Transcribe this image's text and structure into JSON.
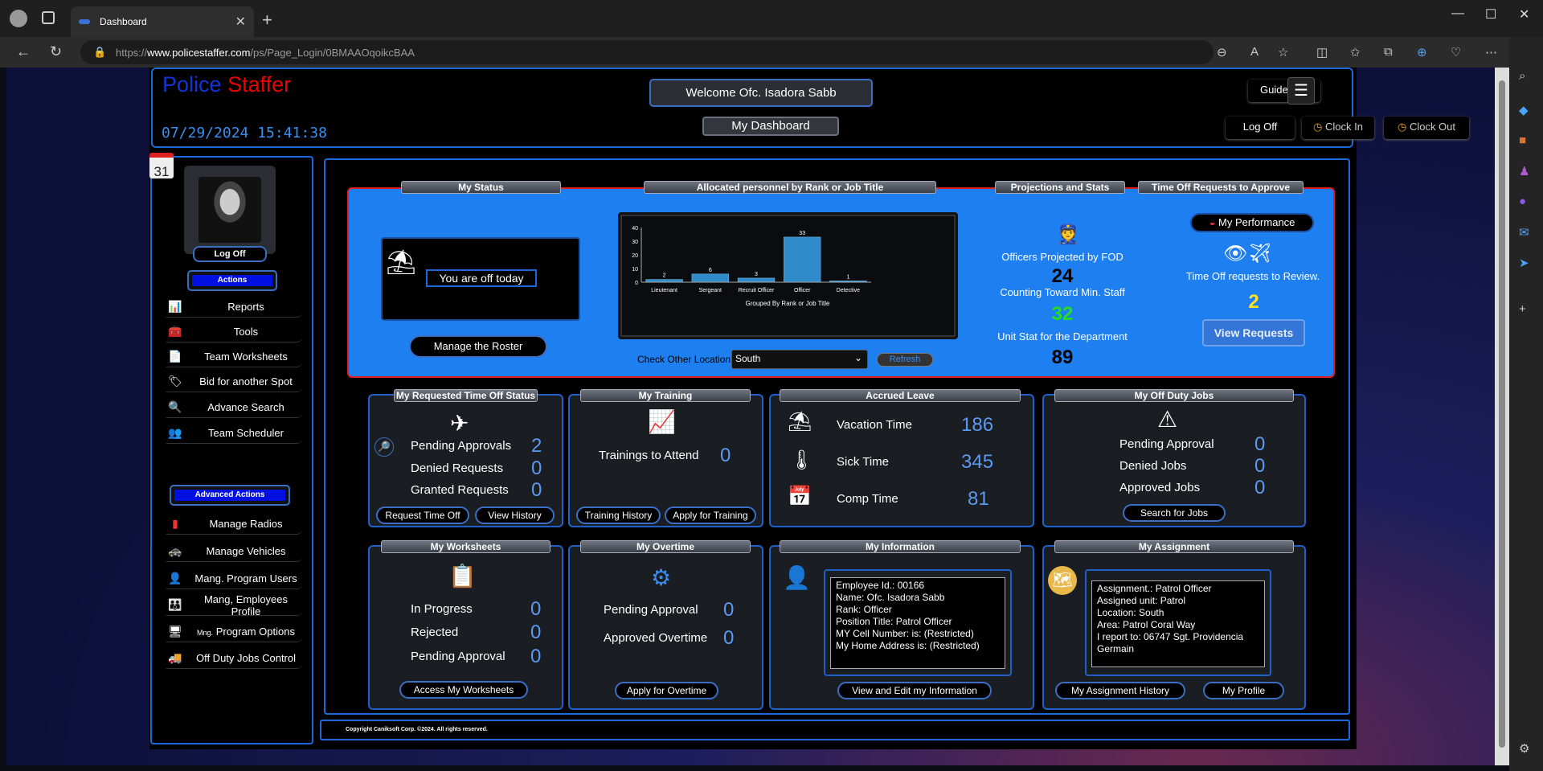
{
  "browser": {
    "tab_title": "Dashboard",
    "url_prefix": "https://",
    "url_host": "www.policestaffer.com",
    "url_path": "/ps/Page_Login/0BMAAOqoikcBAA"
  },
  "header": {
    "logo_police": "Police",
    "logo_staffer": "Staffer",
    "datetime": "07/29/2024 15:41:38",
    "welcome": "Welcome Ofc. Isadora Sabb",
    "page_title": "My Dashboard",
    "guide": "Guide Me.",
    "log_off": "Log Off",
    "clock_in": "Clock In",
    "clock_out": "Clock Out"
  },
  "sidebar": {
    "calendar_day": "31",
    "log_off": "Log Off",
    "actions_label": "Actions",
    "items": [
      "Reports",
      "Tools",
      "Team Worksheets",
      "Bid for another Spot",
      "Advance Search",
      "Team Scheduler"
    ],
    "advanced_label": "Advanced Actions",
    "advanced_items": [
      "Manage Radios",
      "Manage Vehicles",
      "Mang. Program Users",
      "Mang, Employees Profile",
      "Program Options",
      "Off Duty Jobs Control"
    ],
    "program_options_prefix": "Mng."
  },
  "top_panel": {
    "my_status_title": "My Status",
    "off_today": "You are off today",
    "manage_roster": "Manage the Roster",
    "allocated_title": "Allocated personnel by Rank or Job Title",
    "check_location_label": "Check Other Location",
    "location_value": "South",
    "refresh": "Refresh",
    "projections_title": "Projections and Stats",
    "officers_projected_label": "Officers Projected by FOD",
    "officers_projected_value": "24",
    "counting_label": "Counting Toward Min. Staff",
    "counting_value": "32",
    "unit_stat_label": "Unit Stat for the Department",
    "unit_stat_value": "89",
    "time_off_title": "Time Off Requests to Approve",
    "my_performance": "My Performance",
    "review_label": "Time Off requests to Review.",
    "review_value": "2",
    "view_requests": "View Requests"
  },
  "chart_data": {
    "type": "bar",
    "categories": [
      "Lieutenant",
      "Sergeant",
      "Recruit Officer",
      "Officer",
      "Detective"
    ],
    "values": [
      2,
      6,
      3,
      33,
      1
    ],
    "xlabel": "Grouped By Rank or Job Title",
    "ylabel": "",
    "ylim": [
      0,
      40
    ],
    "yticks": [
      "40",
      "30",
      "20",
      "10",
      "0"
    ],
    "bar_color": "#2f8bc9"
  },
  "time_off_status": {
    "title": "My Requested Time Off Status",
    "rows": [
      {
        "label": "Pending Approvals",
        "value": "2"
      },
      {
        "label": "Denied Requests",
        "value": "0"
      },
      {
        "label": "Granted Requests",
        "value": "0"
      }
    ],
    "request_btn": "Request Time Off",
    "history_btn": "View History"
  },
  "training": {
    "title": "My Training",
    "label": "Trainings to Attend",
    "value": "0",
    "history_btn": "Training History",
    "apply_btn": "Apply for Training"
  },
  "leave": {
    "title": "Accrued Leave",
    "rows": [
      {
        "label": "Vacation Time",
        "value": "186"
      },
      {
        "label": "Sick Time",
        "value": "345"
      },
      {
        "label": "Comp Time",
        "value": "81"
      }
    ]
  },
  "off_duty": {
    "title": "My Off Duty Jobs",
    "rows": [
      {
        "label": "Pending Approval",
        "value": "0"
      },
      {
        "label": "Denied Jobs",
        "value": "0"
      },
      {
        "label": "Approved Jobs",
        "value": "0"
      }
    ],
    "search_btn": "Search for Jobs"
  },
  "worksheets": {
    "title": "My Worksheets",
    "rows": [
      {
        "label": "In Progress",
        "value": "0"
      },
      {
        "label": "Rejected",
        "value": "0"
      },
      {
        "label": "Pending Approval",
        "value": "0"
      }
    ],
    "access_btn": "Access My Worksheets"
  },
  "overtime": {
    "title": "My Overtime",
    "rows": [
      {
        "label": "Pending Approval",
        "value": "0"
      },
      {
        "label": "Approved Overtime",
        "value": "0"
      }
    ],
    "apply_btn": "Apply for Overtime"
  },
  "information": {
    "title": "My Information",
    "lines": [
      "Employee Id.: 00166",
      "Name: Ofc. Isadora Sabb",
      "Rank: Officer",
      "Position Title: Patrol Officer",
      "MY Cell Number: is: (Restricted)",
      "My Home Address is: (Restricted)"
    ],
    "edit_btn": "View and Edit my Information"
  },
  "assignment": {
    "title": "My Assignment",
    "lines": [
      "Assignment.: Patrol Officer",
      "Assigned unit: Patrol",
      "Location: South",
      "Area: Patrol Coral Way",
      "I report to: 06747 Sgt. Providencia",
      "Germain"
    ],
    "history_btn": "My Assignment History",
    "profile_btn": "My Profile"
  },
  "footer": {
    "copyright": "Copyright Caniksoft Corp. ©2024. All rights reserved."
  },
  "colors": {
    "accent_blue": "#1e7ff0",
    "green_value": "#22dd22",
    "yellow_value": "#ffe02a",
    "logo_red": "#e00000",
    "logo_blue": "#1235d8"
  }
}
